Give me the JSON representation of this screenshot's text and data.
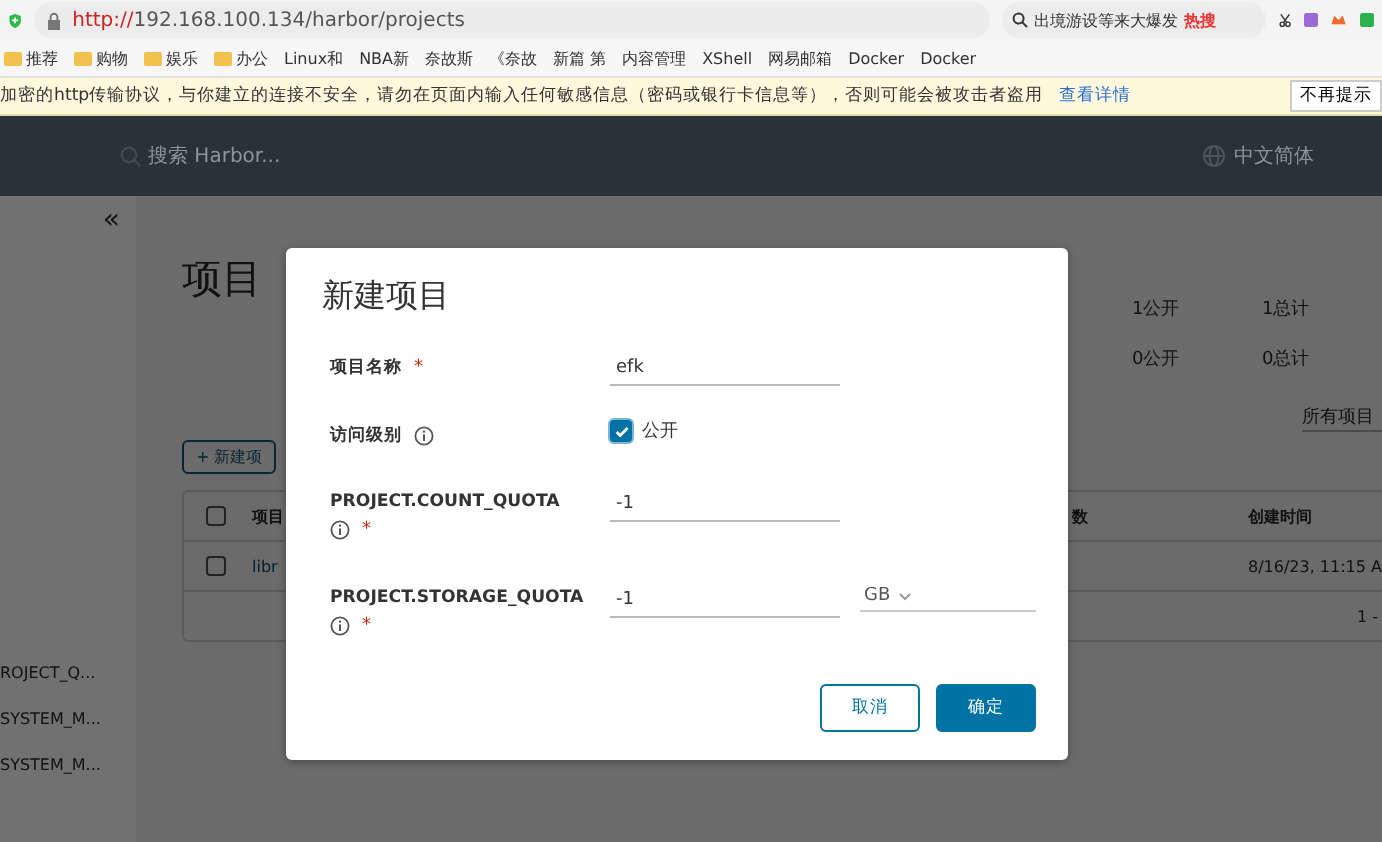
{
  "browser": {
    "url_scheme": "http://",
    "url_rest": "192.168.100.134/harbor/projects",
    "search": "出境游设等来大爆发",
    "hot": "热搜",
    "bookmarks": [
      "推荐",
      "购物",
      "娱乐",
      "办公",
      "Linux和",
      "NBA新",
      "奈故斯",
      "《奈故",
      "新篇 第",
      "内容管理",
      "XShell",
      "网易邮箱",
      "Docker",
      "Docker"
    ],
    "warning": "加密的http传输协议，与你建立的连接不安全，请勿在页面内输入任何敏感信息（密码或银行卡信息等），否则可能会被攻击者盗用",
    "warning_link": "查看详情",
    "dismiss": "不再提示"
  },
  "header": {
    "search_placeholder": "搜索 Harbor...",
    "language": "中文简体"
  },
  "sidebar": {
    "collapse": "«",
    "items": [
      "ROJECT_Q...",
      "SYSTEM_M...",
      "SYSTEM_M..."
    ]
  },
  "page": {
    "title": "项目",
    "stats": [
      [
        "1公开",
        "1总计"
      ],
      [
        "0公开",
        "0总计"
      ]
    ],
    "filter": "所有项目",
    "new_button": "+ 新建项",
    "table": {
      "select_all_checked": false,
      "columns": [
        "项目",
        "数",
        "创建时间"
      ],
      "rows": [
        {
          "checked": false,
          "name": "libr",
          "created": "8/16/23, 11:15 A"
        }
      ],
      "footer": "1 -"
    }
  },
  "dialog": {
    "title": "新建项目",
    "required_mark": "*",
    "fields": [
      {
        "kind": "text",
        "label": "项目名称",
        "required": true,
        "info": false,
        "value": "efk"
      },
      {
        "kind": "checkbox",
        "label": "访问级别",
        "required": false,
        "info": true,
        "checked": true,
        "option": "公开"
      },
      {
        "kind": "text",
        "label": "PROJECT.COUNT_QUOTA",
        "required": true,
        "info": true,
        "value": "-1"
      },
      {
        "kind": "quota",
        "label": "PROJECT.STORAGE_QUOTA",
        "required": true,
        "info": true,
        "value": "-1",
        "unit": "GB"
      }
    ],
    "buttons": [
      {
        "label": "取消",
        "primary": false
      },
      {
        "label": "确定",
        "primary": true
      }
    ]
  }
}
